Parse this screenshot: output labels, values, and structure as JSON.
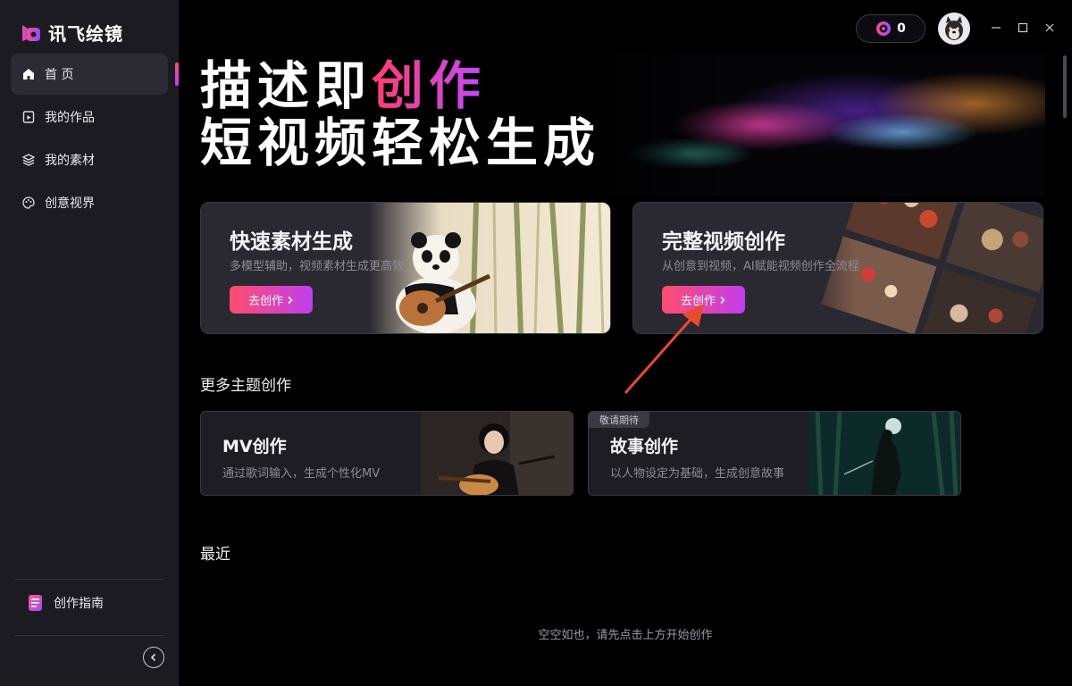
{
  "app": {
    "logo_text": "讯飞绘镜"
  },
  "sidebar": {
    "items": [
      {
        "label": "首 页",
        "icon": "home-icon"
      },
      {
        "label": "我的作品",
        "icon": "works-icon"
      },
      {
        "label": "我的素材",
        "icon": "layers-icon"
      },
      {
        "label": "创意视界",
        "icon": "palette-icon"
      }
    ],
    "guide_label": "创作指南"
  },
  "topbar": {
    "coin_count": "0"
  },
  "hero": {
    "line1_a": "描述即",
    "line1_b": "创作",
    "line2": "短视频轻松生成"
  },
  "cards": [
    {
      "title": "快速素材生成",
      "subtitle": "多模型辅助，视频素材生成更高效",
      "button": "去创作"
    },
    {
      "title": "完整视频创作",
      "subtitle": "从创意到视频，AI赋能视频创作全流程",
      "button": "去创作"
    }
  ],
  "more_section": {
    "title": "更多主题创作"
  },
  "themes": [
    {
      "title": "MV创作",
      "subtitle": "通过歌词输入，生成个性化MV"
    },
    {
      "title": "故事创作",
      "subtitle": "以人物设定为基础，生成创意故事",
      "badge": "敬请期待"
    }
  ],
  "recent": {
    "title": "最近",
    "empty_text": "空空如也，请先点击上方开始创作"
  },
  "colors": {
    "accent_start": "#ff4d6d",
    "accent_end": "#c13df0",
    "sidebar_bg": "#1c1b22"
  }
}
